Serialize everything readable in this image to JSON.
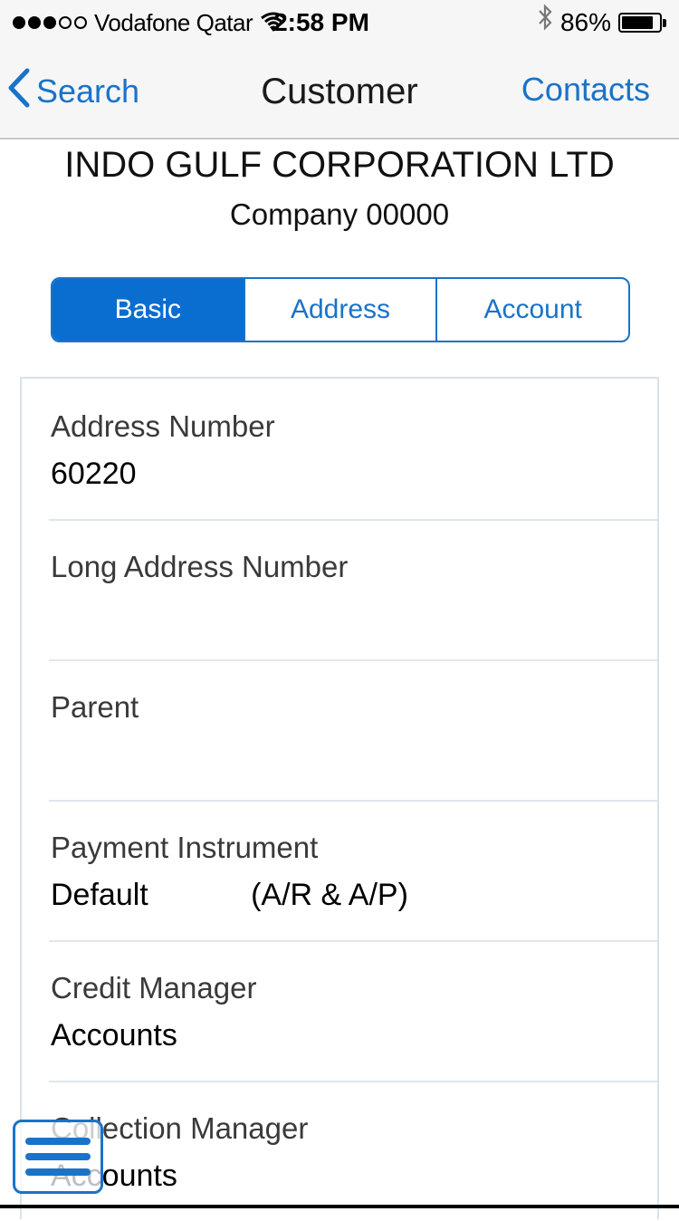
{
  "status_bar": {
    "carrier": "Vodafone Qatar",
    "time": "2:58 PM",
    "battery": "86%",
    "battery_level": 0.86,
    "signal_bars_filled": 3,
    "signal_bars_total": 5
  },
  "nav": {
    "back_label": "Search",
    "title": "Customer",
    "right_label": "Contacts"
  },
  "header": {
    "company_name": "INDO GULF CORPORATION LTD",
    "company_sub": "Company 00000"
  },
  "tabs": [
    {
      "label": "Basic",
      "active": true
    },
    {
      "label": "Address",
      "active": false
    },
    {
      "label": "Account",
      "active": false
    }
  ],
  "fields": [
    {
      "label": "Address Number",
      "value": "60220"
    },
    {
      "label": "Long Address Number",
      "value": ""
    },
    {
      "label": "Parent",
      "value": ""
    },
    {
      "label": "Payment Instrument",
      "value": "Default            (A/R & A/P)"
    },
    {
      "label": "Credit Manager",
      "value": "Accounts"
    },
    {
      "label": "Collection Manager",
      "value": "Accounts"
    }
  ],
  "colors": {
    "accent": "#1a73c8",
    "active_tab_bg": "#0a6ed1",
    "bar_bg": "#f6f6f6"
  },
  "icons": {
    "back": "chevron-left-icon",
    "wifi": "wifi-icon",
    "bluetooth": "bluetooth-icon",
    "menu": "hamburger-menu-icon"
  }
}
